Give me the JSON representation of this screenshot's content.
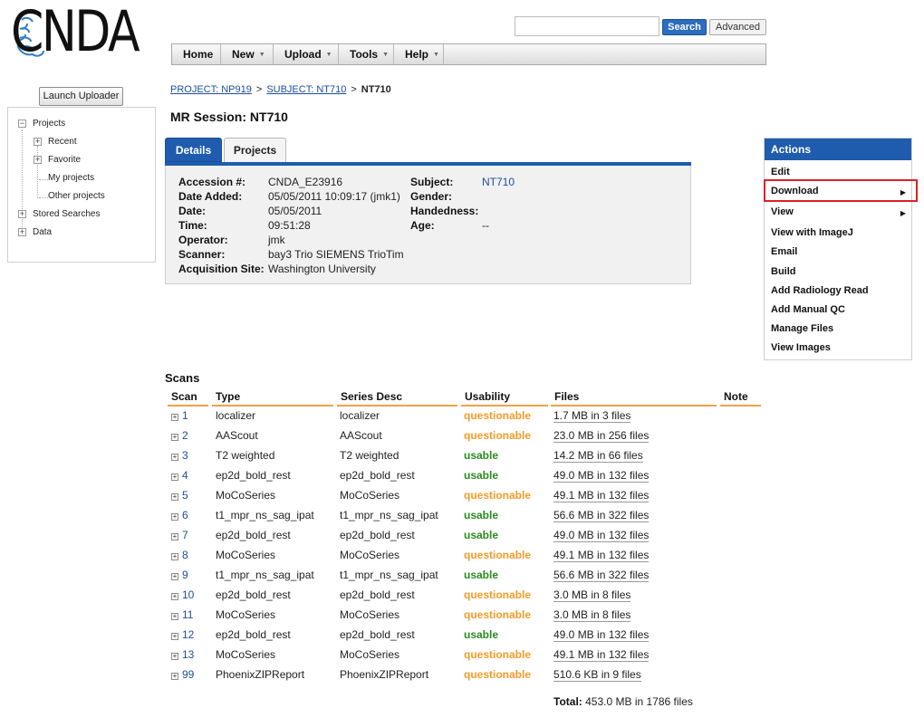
{
  "logo": {
    "text": "CNDA"
  },
  "search": {
    "placeholder": "",
    "value": "",
    "search_label": "Search",
    "advanced_label": "Advanced"
  },
  "nav": [
    {
      "label": "Home",
      "dropdown": false
    },
    {
      "label": "New",
      "dropdown": true
    },
    {
      "label": "Upload",
      "dropdown": true
    },
    {
      "label": "Tools",
      "dropdown": true
    },
    {
      "label": "Help",
      "dropdown": true
    }
  ],
  "sidebar": {
    "launch_label": "Launch Uploader",
    "tree": {
      "projects": "Projects",
      "recent": "Recent",
      "favorite": "Favorite",
      "my_projects": "My projects",
      "other_projects": "Other projects",
      "stored_searches": "Stored Searches",
      "data": "Data"
    }
  },
  "breadcrumb": {
    "project": "PROJECT: NP919",
    "subject": "SUBJECT: NT710",
    "current": "NT710",
    "sep": ">"
  },
  "page_title": "MR Session: NT710",
  "tabs": {
    "details": "Details",
    "projects": "Projects"
  },
  "details": {
    "accession_label": "Accession #:",
    "accession": "CNDA_E23916",
    "date_added_label": "Date Added:",
    "date_added": "05/05/2011 10:09:17 (jmk1)",
    "date_label": "Date:",
    "date": "05/05/2011",
    "time_label": "Time:",
    "time": "09:51:28",
    "operator_label": "Operator:",
    "operator": "jmk",
    "scanner_label": "Scanner:",
    "scanner": "bay3 Trio SIEMENS TrioTim",
    "site_label": "Acquisition Site:",
    "site": "Washington University",
    "subject_label": "Subject:",
    "subject": "NT710",
    "gender_label": "Gender:",
    "handedness_label": "Handedness:",
    "age_label": "Age:",
    "age": "--"
  },
  "actions": {
    "title": "Actions",
    "items": {
      "edit": "Edit",
      "download": "Download",
      "view": "View",
      "imagej": "View with ImageJ",
      "email": "Email",
      "build": "Build",
      "radiology": "Add Radiology Read",
      "manual_qc": "Add Manual QC",
      "manage_files": "Manage Files",
      "view_images": "View Images"
    }
  },
  "scans": {
    "title": "Scans",
    "headers": {
      "scan": "Scan",
      "type": "Type",
      "series": "Series Desc",
      "usability": "Usability",
      "files": "Files",
      "note": "Note"
    },
    "rows": [
      {
        "scan": "1",
        "type": "localizer",
        "series": "localizer",
        "usability": "questionable",
        "files": "1.7 MB in 3 files"
      },
      {
        "scan": "2",
        "type": "AAScout",
        "series": "AAScout",
        "usability": "questionable",
        "files": "23.0 MB in 256 files"
      },
      {
        "scan": "3",
        "type": "T2 weighted",
        "series": "T2 weighted",
        "usability": "usable",
        "files": "14.2 MB in 66 files"
      },
      {
        "scan": "4",
        "type": "ep2d_bold_rest",
        "series": "ep2d_bold_rest",
        "usability": "usable",
        "files": "49.0 MB in 132 files"
      },
      {
        "scan": "5",
        "type": "MoCoSeries",
        "series": "MoCoSeries",
        "usability": "questionable",
        "files": "49.1 MB in 132 files"
      },
      {
        "scan": "6",
        "type": "t1_mpr_ns_sag_ipat",
        "series": "t1_mpr_ns_sag_ipat",
        "usability": "usable",
        "files": "56.6 MB in 322 files"
      },
      {
        "scan": "7",
        "type": "ep2d_bold_rest",
        "series": "ep2d_bold_rest",
        "usability": "usable",
        "files": "49.0 MB in 132 files"
      },
      {
        "scan": "8",
        "type": "MoCoSeries",
        "series": "MoCoSeries",
        "usability": "questionable",
        "files": "49.1 MB in 132 files"
      },
      {
        "scan": "9",
        "type": "t1_mpr_ns_sag_ipat",
        "series": "t1_mpr_ns_sag_ipat",
        "usability": "usable",
        "files": "56.6 MB in 322 files"
      },
      {
        "scan": "10",
        "type": "ep2d_bold_rest",
        "series": "ep2d_bold_rest",
        "usability": "questionable",
        "files": "3.0 MB in 8 files"
      },
      {
        "scan": "11",
        "type": "MoCoSeries",
        "series": "MoCoSeries",
        "usability": "questionable",
        "files": "3.0 MB in 8 files"
      },
      {
        "scan": "12",
        "type": "ep2d_bold_rest",
        "series": "ep2d_bold_rest",
        "usability": "usable",
        "files": "49.0 MB in 132 files"
      },
      {
        "scan": "13",
        "type": "MoCoSeries",
        "series": "MoCoSeries",
        "usability": "questionable",
        "files": "49.1 MB in 132 files"
      },
      {
        "scan": "99",
        "type": "PhoenixZIPReport",
        "series": "PhoenixZIPReport",
        "usability": "questionable",
        "files": "510.6 KB in 9 files"
      }
    ],
    "total_label": "Total:",
    "total": "453.0 MB in 1786 files"
  },
  "colors": {
    "accent": "#1f5cae",
    "questionable": "#f39b28",
    "usable": "#2a8a1f",
    "highlight": "#dc1f26",
    "header_rule": "#f0a14a"
  }
}
